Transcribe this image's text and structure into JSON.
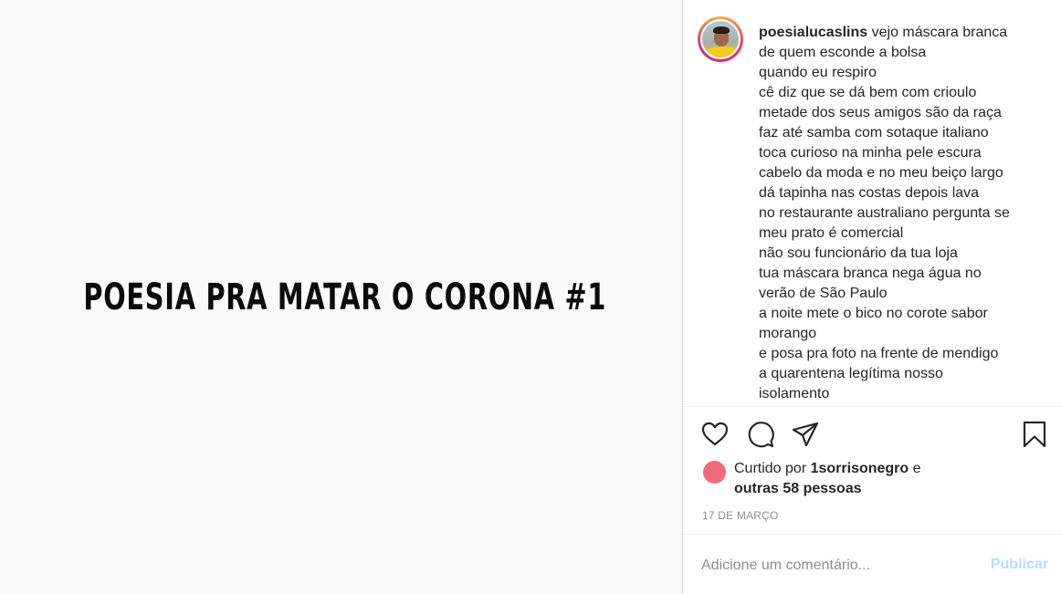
{
  "post": {
    "image_title": "POESIA PRA MATAR O CORONA #1"
  },
  "caption": {
    "username": "poesialucaslins",
    "text": " vejo máscara branca\nde quem esconde a bolsa\nquando eu respiro\ncê diz que se dá bem com crioulo\nmetade dos seus amigos são da raça\nfaz até samba com sotaque italiano\ntoca curioso na minha pele escura\ncabelo da moda e no meu beiço largo\ndá tapinha nas costas depois lava\nno restaurante australiano pergunta se\nmeu prato é comercial\nnão sou funcionário da tua loja\ntua máscara branca nega água no\nverão de São Paulo\na noite mete o bico no corote sabor\nmorango\ne posa pra foto na frente de mendigo\na quarentena legítima nosso\nisolamento"
  },
  "actions": {
    "icons": [
      "heart-icon",
      "comment-icon",
      "share-icon",
      "bookmark-icon"
    ]
  },
  "likes": {
    "prefix": "Curtido por ",
    "user": "1sorrisonegro",
    "connector": " e",
    "others": "outras 58 pessoas"
  },
  "date": "17 DE MARÇO",
  "comment": {
    "placeholder": "Adicione um comentário...",
    "publish_label": "Publicar"
  },
  "colors": {
    "publish_disabled": "#b2dffc",
    "likes_avatar": "#f06a7d",
    "muted_text": "#8e8e8e"
  }
}
